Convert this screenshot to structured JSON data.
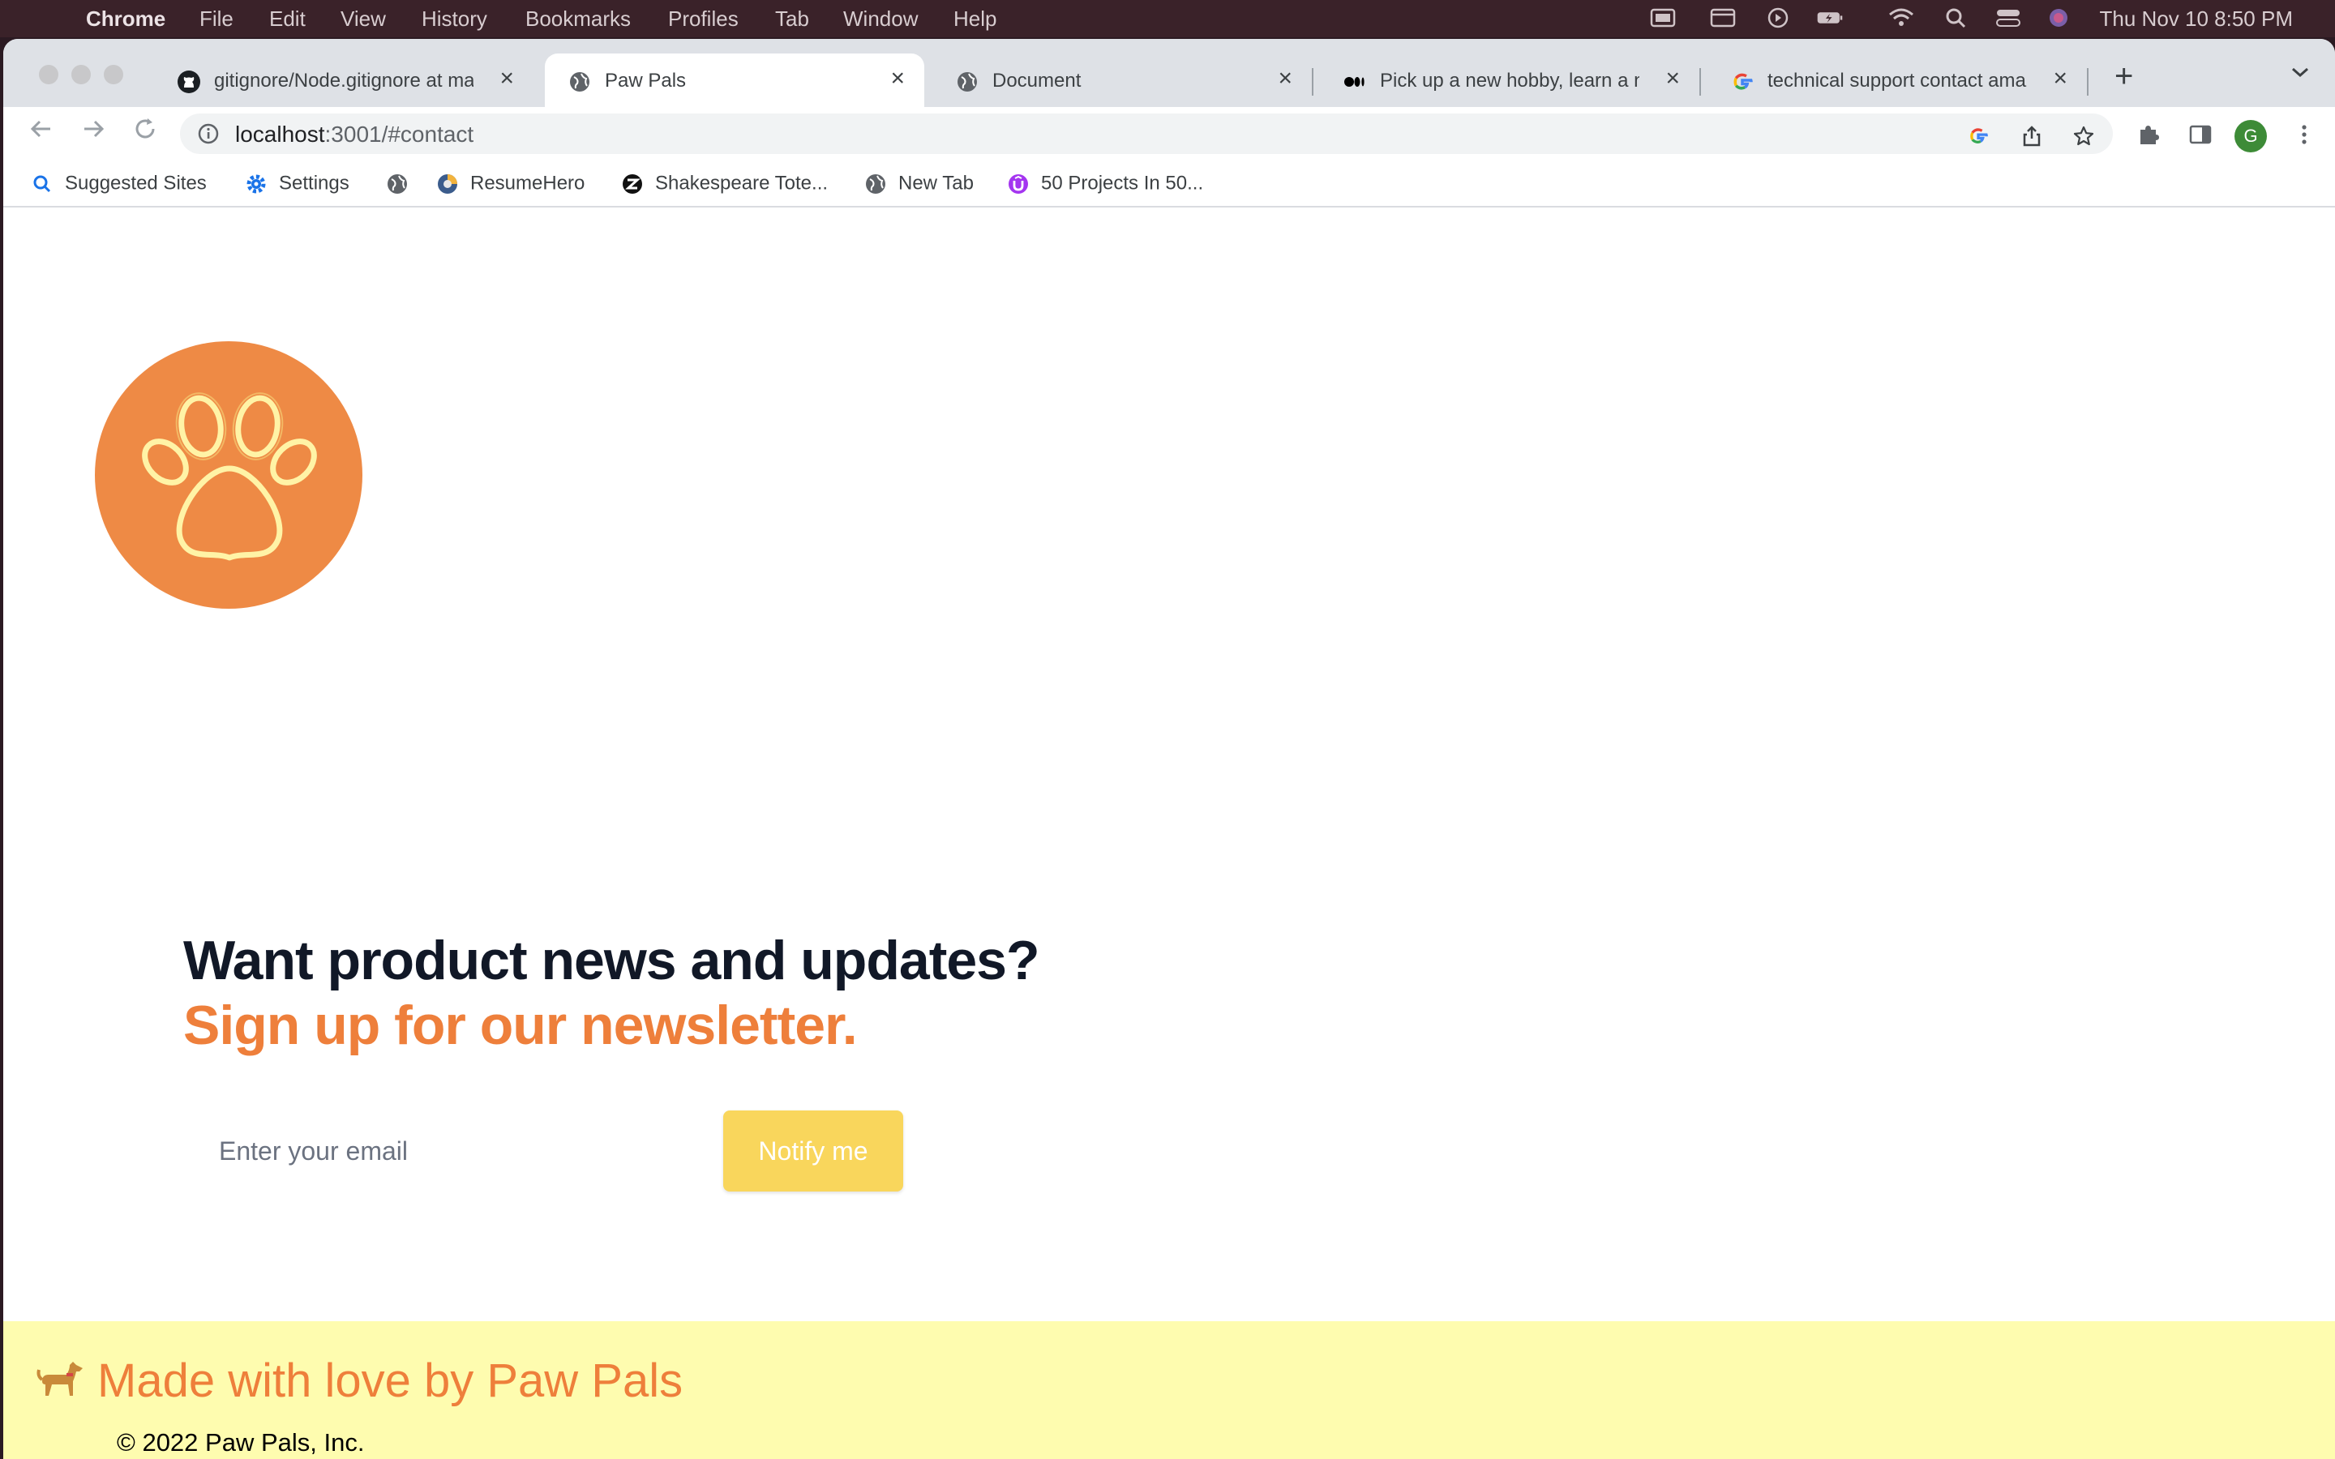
{
  "menubar": {
    "app_name": "Chrome",
    "items": [
      "File",
      "Edit",
      "View",
      "History",
      "Bookmarks",
      "Profiles",
      "Tab",
      "Window",
      "Help"
    ],
    "clock": "Thu Nov 10  8:50 PM"
  },
  "tabs": [
    {
      "title": "gitignore/Node.gitignore at main",
      "icon": "github-icon",
      "active": false
    },
    {
      "title": "Paw Pals",
      "icon": "globe-icon",
      "active": true
    },
    {
      "title": "Document",
      "icon": "globe-icon",
      "active": false
    },
    {
      "title": "Pick up a new hobby, learn a new",
      "icon": "medium-icon",
      "active": false
    },
    {
      "title": "technical support contact amazon",
      "icon": "google-icon",
      "active": false
    }
  ],
  "address_bar": {
    "host": "localhost",
    "path": ":3001/#contact"
  },
  "profile": {
    "initial": "G",
    "color": "#3d8b37"
  },
  "bookmarks": [
    {
      "label": "Suggested Sites",
      "icon": "search-icon"
    },
    {
      "label": "Settings",
      "icon": "gear-icon"
    },
    {
      "label": "",
      "icon": "globe-icon"
    },
    {
      "label": "ResumeHero",
      "icon": "resumehero-icon"
    },
    {
      "label": "Shakespeare Tote...",
      "icon": "zazzle-icon"
    },
    {
      "label": "New Tab",
      "icon": "globe-icon"
    },
    {
      "label": "50 Projects In 50...",
      "icon": "udemy-icon"
    }
  ],
  "page": {
    "logo_color": "#ee8a45",
    "headline": "Want product news and updates?",
    "subline": "Sign up for our newsletter.",
    "email_placeholder": "Enter your email",
    "button_label": "Notify me",
    "accent_color": "#ee7f3b",
    "button_color": "#f9d65c"
  },
  "footer": {
    "made_with": "Made with love by Paw Pals",
    "copyright": "© 2022 Paw Pals, Inc.",
    "background": "#fefcaf"
  }
}
